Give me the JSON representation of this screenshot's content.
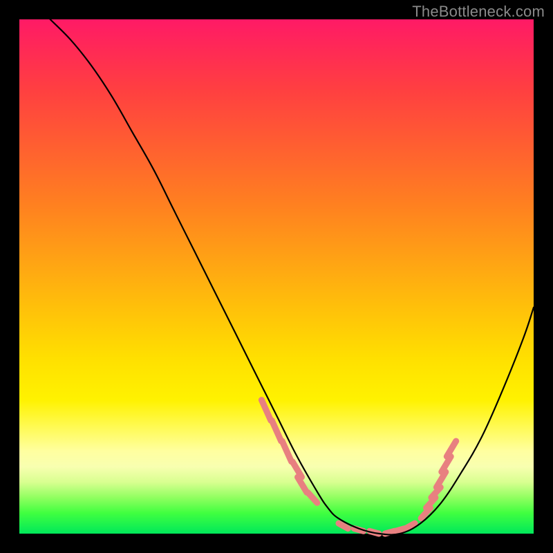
{
  "watermark": "TheBottleneck.com",
  "chart_data": {
    "type": "line",
    "title": "",
    "xlabel": "",
    "ylabel": "",
    "xlim": [
      0,
      100
    ],
    "ylim": [
      0,
      100
    ],
    "grid": false,
    "legend": false,
    "series": [
      {
        "name": "bottleneck-curve",
        "color": "#000000",
        "x": [
          6,
          10,
          14,
          18,
          22,
          26,
          30,
          34,
          38,
          42,
          46,
          50,
          54,
          58,
          60,
          62,
          66,
          70,
          74,
          78,
          82,
          86,
          90,
          94,
          98,
          100
        ],
        "values": [
          100,
          96,
          91,
          85,
          78,
          71,
          63,
          55,
          47,
          39,
          31,
          23,
          15,
          8,
          5,
          3,
          1,
          0,
          0,
          2,
          6,
          12,
          19,
          28,
          38,
          44
        ]
      }
    ],
    "markers": {
      "name": "highlight-dashes",
      "color": "#e88080",
      "stroke_width": 9,
      "segments": [
        {
          "x": 48,
          "y0": 26,
          "y1": 22
        },
        {
          "x": 50,
          "y0": 22,
          "y1": 18
        },
        {
          "x": 52,
          "y0": 18,
          "y1": 14
        },
        {
          "x": 54,
          "y0": 14,
          "y1": 11
        },
        {
          "x": 55,
          "y0": 11,
          "y1": 8
        },
        {
          "x": 57,
          "y0": 8,
          "y1": 6
        },
        {
          "x": 63,
          "y0": 2,
          "y1": 1
        },
        {
          "x": 66,
          "y0": 1,
          "y1": 0.5
        },
        {
          "x": 69,
          "y0": 0.5,
          "y1": 0
        },
        {
          "x": 72,
          "y0": 0,
          "y1": 0.5
        },
        {
          "x": 74,
          "y0": 0.5,
          "y1": 1
        },
        {
          "x": 76,
          "y0": 1,
          "y1": 2
        },
        {
          "x": 79,
          "y0": 3,
          "y1": 5
        },
        {
          "x": 80,
          "y0": 5,
          "y1": 7
        },
        {
          "x": 81,
          "y0": 7,
          "y1": 9
        },
        {
          "x": 82,
          "y0": 9,
          "y1": 12
        },
        {
          "x": 83,
          "y0": 12,
          "y1": 15
        },
        {
          "x": 84,
          "y0": 15,
          "y1": 18
        }
      ]
    },
    "gradient_stops": [
      {
        "pct": 0,
        "color": "#ff1a66"
      },
      {
        "pct": 25,
        "color": "#ff6030"
      },
      {
        "pct": 56,
        "color": "#ffc00a"
      },
      {
        "pct": 80,
        "color": "#fffb60"
      },
      {
        "pct": 100,
        "color": "#00e85a"
      }
    ]
  }
}
